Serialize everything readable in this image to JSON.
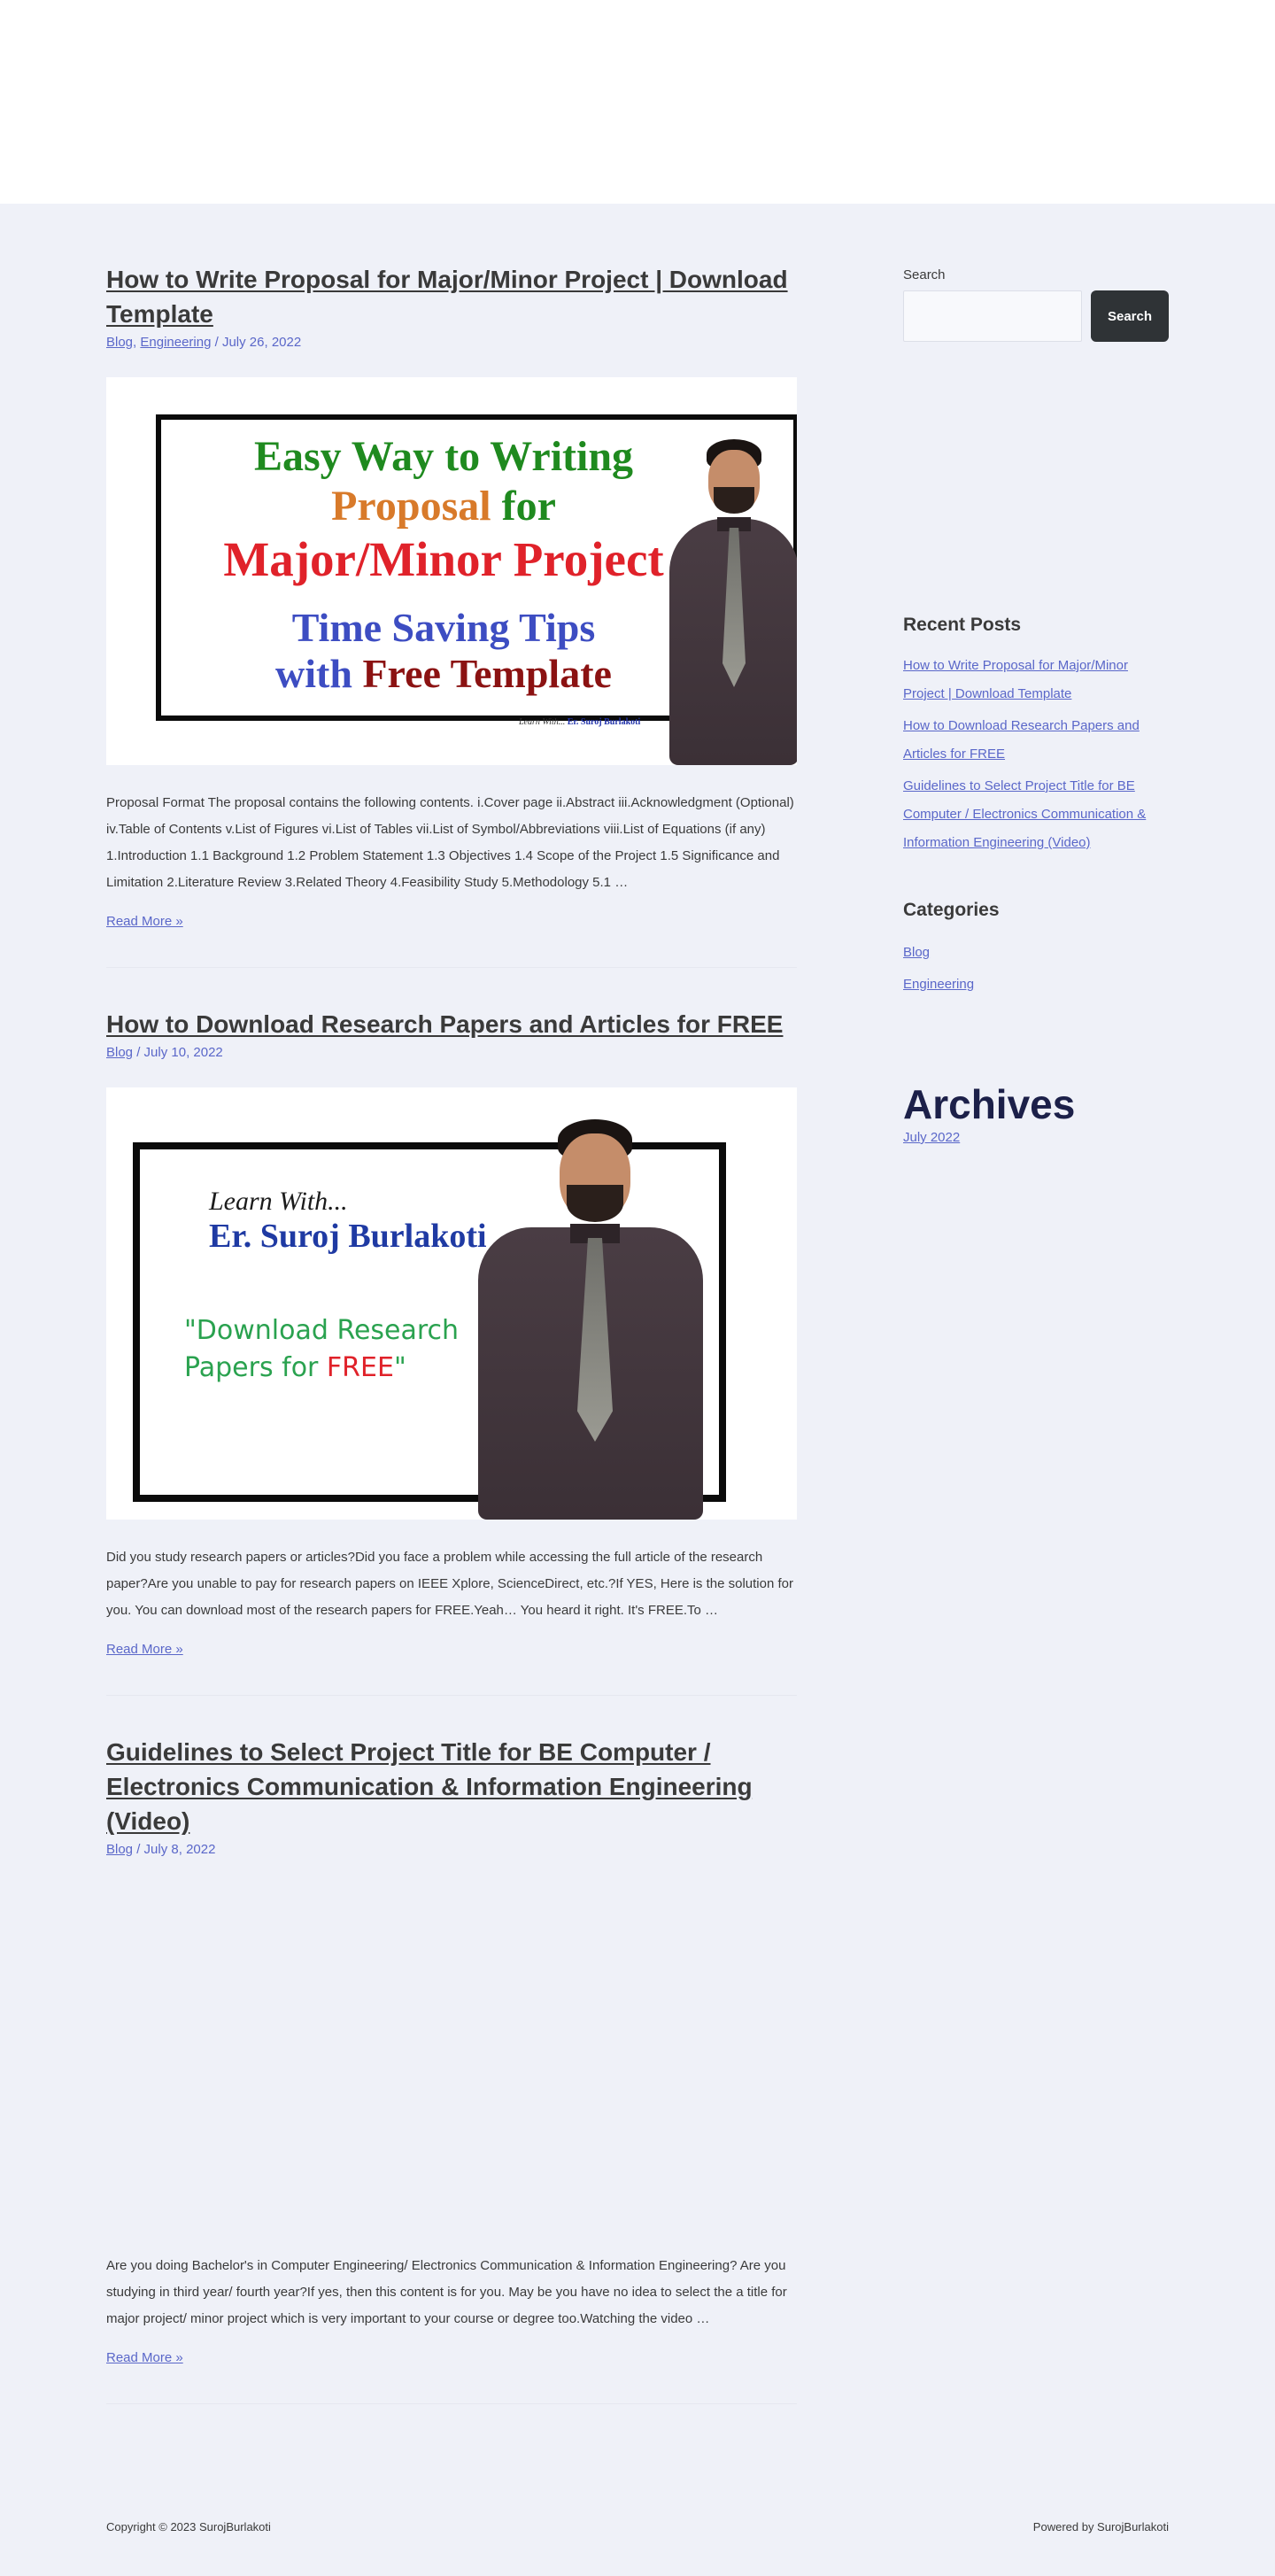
{
  "posts": [
    {
      "title": "How to Write Proposal for Major/Minor Project | Download Template",
      "categories": [
        "Blog",
        "Engineering"
      ],
      "date": "July 26, 2022",
      "thumbnail": {
        "line1": "Easy Way to Writing",
        "line2a": "Proposal",
        "line2b": " for",
        "line3": "Major/Minor Project",
        "line4": "Time Saving Tips",
        "line5a": "with ",
        "line5b": "Free Template",
        "sig_a": "Learn With... ",
        "sig_b": "Er. Suroj Burlakoti"
      },
      "excerpt": "Proposal Format The proposal contains the following contents. i.Cover page ii.Abstract iii.Acknowledgment (Optional) iv.Table of Contents v.List of Figures vi.List of Tables vii.List of Symbol/Abbreviations viii.List of Equations (if any) 1.Introduction 1.1 Background 1.2 Problem Statement 1.3 Objectives 1.4 Scope of the Project 1.5 Significance and Limitation 2.Literature Review 3.Related Theory 4.Feasibility Study 5.Methodology 5.1 …",
      "read_more": "Read More »"
    },
    {
      "title": "How to Download Research Papers and Articles for FREE",
      "categories": [
        "Blog"
      ],
      "date": "July 10, 2022",
      "thumbnail": {
        "learn": "Learn With...",
        "name": "Er. Suroj Burlakoti",
        "quote_a": "\"Download Research",
        "quote_b": "Papers for ",
        "quote_c": "FREE",
        "quote_d": "\""
      },
      "excerpt": "Did you study research papers or articles?Did you face a problem while accessing the full article of the research paper?Are you unable to pay for research papers on IEEE Xplore, ScienceDirect, etc.?If YES, Here is the solution for you. You can download most of the research papers for FREE.Yeah… You heard it right. It's FREE.To …",
      "read_more": "Read More »"
    },
    {
      "title": "Guidelines to Select Project Title for BE Computer / Electronics Communication & Information Engineering (Video)",
      "categories": [
        "Blog"
      ],
      "date": "July 8, 2022",
      "excerpt": "Are you doing Bachelor's in Computer Engineering/ Electronics Communication & Information Engineering? Are you studying in third year/ fourth year?If yes, then this content is for you. May be you have no idea to select the a title for major project/ minor project which is very important to your course or degree too.Watching the video …",
      "read_more": "Read More »"
    }
  ],
  "meta_sep": " / ",
  "cat_sep": ", ",
  "sidebar": {
    "search_label": "Search",
    "search_value": "",
    "search_button": "Search",
    "recent_title": "Recent Posts",
    "recent_posts": [
      "How to Write Proposal for Major/Minor Project | Download Template",
      "How to Download Research Papers and Articles for FREE",
      "Guidelines to Select Project Title for BE Computer / Electronics Communication & Information Engineering (Video)"
    ],
    "categories_title": "Categories",
    "categories": [
      "Blog",
      "Engineering"
    ],
    "archives_title": "Archives",
    "archives": [
      "July 2022"
    ]
  },
  "footer": {
    "copyright": "Copyright © 2023 SurojBurlakoti",
    "powered": "Powered by SurojBurlakoti"
  },
  "colors": {
    "link": "#5a67c9",
    "background": "#eff1f8",
    "button": "#2f3336",
    "archives_heading": "#1c2049"
  }
}
